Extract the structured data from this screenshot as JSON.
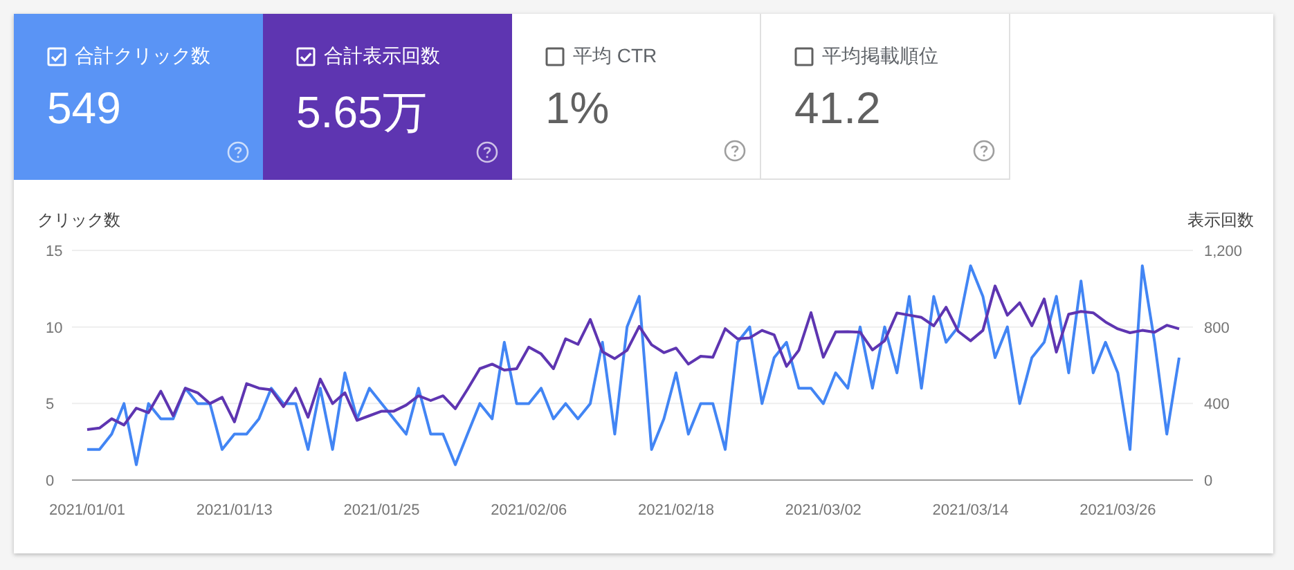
{
  "metrics": [
    {
      "label": "合計クリック数",
      "value": "549",
      "selected": true,
      "color": "#5a94f5"
    },
    {
      "label": "合計表示回数",
      "value": "5.65万",
      "selected": true,
      "color": "#5e35b1"
    },
    {
      "label": "平均 CTR",
      "value": "1%",
      "selected": false
    },
    {
      "label": "平均掲載順位",
      "value": "41.2",
      "selected": false
    }
  ],
  "chart": {
    "chart_data": {
      "type": "line",
      "ylabel": "クリック数",
      "y2label": "表示回数",
      "categories": [
        "2021/01/01",
        null,
        null,
        null,
        null,
        null,
        null,
        null,
        null,
        null,
        null,
        null,
        "2021/01/13",
        null,
        null,
        null,
        null,
        null,
        null,
        null,
        null,
        null,
        null,
        null,
        "2021/01/25",
        null,
        null,
        null,
        null,
        null,
        null,
        null,
        null,
        null,
        null,
        null,
        "2021/02/06",
        null,
        null,
        null,
        null,
        null,
        null,
        null,
        null,
        null,
        null,
        null,
        "2021/02/18",
        null,
        null,
        null,
        null,
        null,
        null,
        null,
        null,
        null,
        null,
        null,
        "2021/03/02",
        null,
        null,
        null,
        null,
        null,
        null,
        null,
        null,
        null,
        null,
        null,
        "2021/03/14",
        null,
        null,
        null,
        null,
        null,
        null,
        null,
        null,
        null,
        null,
        null,
        "2021/03/26",
        null,
        null,
        null,
        null,
        null
      ],
      "ylim": [
        0,
        15
      ],
      "yticks": [
        0,
        5,
        10,
        15
      ],
      "y2lim": [
        0,
        1200
      ],
      "y2ticks": [
        {
          "value": 0,
          "label": "0"
        },
        {
          "value": 400,
          "label": "400"
        },
        {
          "value": 800,
          "label": "800"
        },
        {
          "value": 1200,
          "label": "1,200"
        }
      ],
      "series": [
        {
          "color": "#4285f4",
          "values": [
            2,
            2,
            3,
            5,
            1,
            5,
            4,
            4,
            6,
            5,
            5,
            2,
            3,
            3,
            4,
            6,
            5,
            5,
            2,
            6,
            2,
            7,
            4,
            6,
            5,
            4,
            3,
            6,
            3,
            3,
            1,
            3,
            5,
            4,
            9,
            5,
            5,
            6,
            4,
            5,
            4,
            5,
            9,
            3,
            10,
            12,
            2,
            4,
            7,
            3,
            5,
            5,
            2,
            9,
            10,
            5,
            8,
            9,
            6,
            6,
            5,
            7,
            6,
            10,
            6,
            10,
            7,
            12,
            6,
            12,
            9,
            10,
            14,
            12,
            8,
            10,
            5,
            8,
            9,
            12,
            7,
            13,
            7,
            9,
            7,
            2,
            14,
            9,
            3,
            8
          ]
        },
        {
          "color": "#5e35b1",
          "axis": "y2",
          "values": [
            264,
            272,
            320,
            288,
            376,
            352,
            464,
            336,
            480,
            456,
            400,
            432,
            304,
            504,
            480,
            472,
            384,
            480,
            328,
            528,
            400,
            456,
            312,
            336,
            360,
            360,
            392,
            440,
            416,
            440,
            373,
            474,
            582,
            606,
            575,
            582,
            695,
            659,
            582,
            738,
            709,
            839,
            671,
            635,
            678,
            803,
            707,
            666,
            690,
            606,
            647,
            642,
            791,
            738,
            743,
            782,
            758,
            594,
            678,
            875,
            642,
            774,
            776,
            773,
            680,
            728,
            873,
            862,
            850,
            806,
            903,
            777,
            728,
            782,
            1014,
            862,
            927,
            806,
            946,
            669,
            867,
            881,
            874,
            826,
            790,
            770,
            782,
            773,
            809,
            790
          ]
        }
      ]
    }
  }
}
